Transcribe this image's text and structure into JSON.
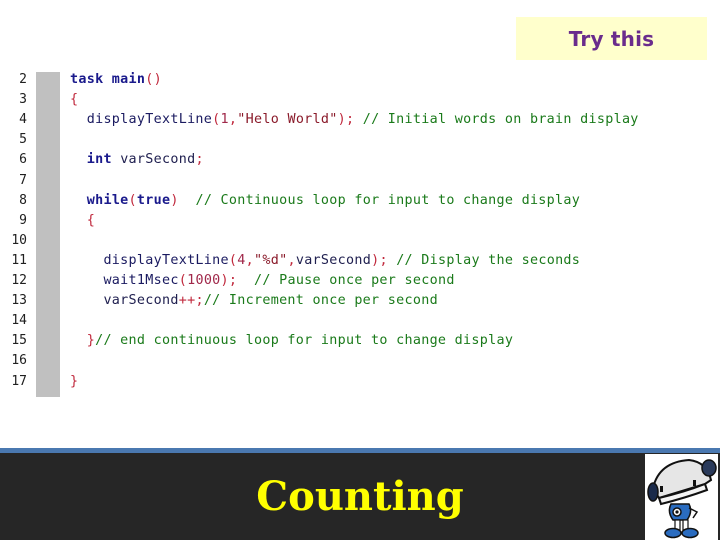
{
  "callout": {
    "label": "Try this",
    "background": "#ffffcc",
    "text_color": "#6a2c8c"
  },
  "editor": {
    "lines": [
      {
        "num": "2",
        "tokens": [
          {
            "t": "task main",
            "c": "kw"
          },
          {
            "t": "()",
            "c": "punc"
          }
        ]
      },
      {
        "num": "3",
        "tokens": [
          {
            "t": "{",
            "c": "punc"
          }
        ]
      },
      {
        "num": "4",
        "tokens": [
          {
            "t": "  displayTextLine",
            "c": "fn"
          },
          {
            "t": "(",
            "c": "punc"
          },
          {
            "t": "1",
            "c": "num"
          },
          {
            "t": ",",
            "c": "punc"
          },
          {
            "t": "\"Helo World\"",
            "c": "str"
          },
          {
            "t": ");",
            "c": "punc"
          },
          {
            "t": " // Initial words on brain display",
            "c": "cmt"
          }
        ]
      },
      {
        "num": "5",
        "tokens": []
      },
      {
        "num": "6",
        "tokens": [
          {
            "t": "  ",
            "c": "var"
          },
          {
            "t": "int",
            "c": "kw"
          },
          {
            "t": " varSecond",
            "c": "var"
          },
          {
            "t": ";",
            "c": "punc"
          }
        ]
      },
      {
        "num": "7",
        "tokens": []
      },
      {
        "num": "8",
        "tokens": [
          {
            "t": "  ",
            "c": "var"
          },
          {
            "t": "while",
            "c": "kw"
          },
          {
            "t": "(",
            "c": "punc"
          },
          {
            "t": "true",
            "c": "kw"
          },
          {
            "t": ")",
            "c": "punc"
          },
          {
            "t": "  // Continuous loop for input to change display",
            "c": "cmt"
          }
        ]
      },
      {
        "num": "9",
        "tokens": [
          {
            "t": "  {",
            "c": "punc"
          }
        ]
      },
      {
        "num": "10",
        "tokens": []
      },
      {
        "num": "11",
        "tokens": [
          {
            "t": "    displayTextLine",
            "c": "fn"
          },
          {
            "t": "(",
            "c": "punc"
          },
          {
            "t": "4",
            "c": "num"
          },
          {
            "t": ",",
            "c": "punc"
          },
          {
            "t": "\"%d\"",
            "c": "str"
          },
          {
            "t": ",",
            "c": "punc"
          },
          {
            "t": "varSecond",
            "c": "var"
          },
          {
            "t": ");",
            "c": "punc"
          },
          {
            "t": " // Display the seconds",
            "c": "cmt"
          }
        ]
      },
      {
        "num": "12",
        "tokens": [
          {
            "t": "    wait1Msec",
            "c": "fn"
          },
          {
            "t": "(",
            "c": "punc"
          },
          {
            "t": "1000",
            "c": "num"
          },
          {
            "t": ");",
            "c": "punc"
          },
          {
            "t": "  // Pause once per second",
            "c": "cmt"
          }
        ]
      },
      {
        "num": "13",
        "tokens": [
          {
            "t": "    varSecond",
            "c": "var"
          },
          {
            "t": "++;",
            "c": "punc"
          },
          {
            "t": "// Increment once per second",
            "c": "cmt"
          }
        ]
      },
      {
        "num": "14",
        "tokens": []
      },
      {
        "num": "15",
        "tokens": [
          {
            "t": "  }",
            "c": "punc"
          },
          {
            "t": "// end continuous loop for input to change display",
            "c": "cmt"
          }
        ]
      },
      {
        "num": "16",
        "tokens": []
      },
      {
        "num": "17",
        "tokens": [
          {
            "t": "}",
            "c": "punc"
          }
        ]
      }
    ]
  },
  "footer": {
    "title": "Counting",
    "title_color": "#ffff00",
    "background": "#262626",
    "rule_color": "#4a78b0",
    "logo": "robot-mascot-icon"
  }
}
